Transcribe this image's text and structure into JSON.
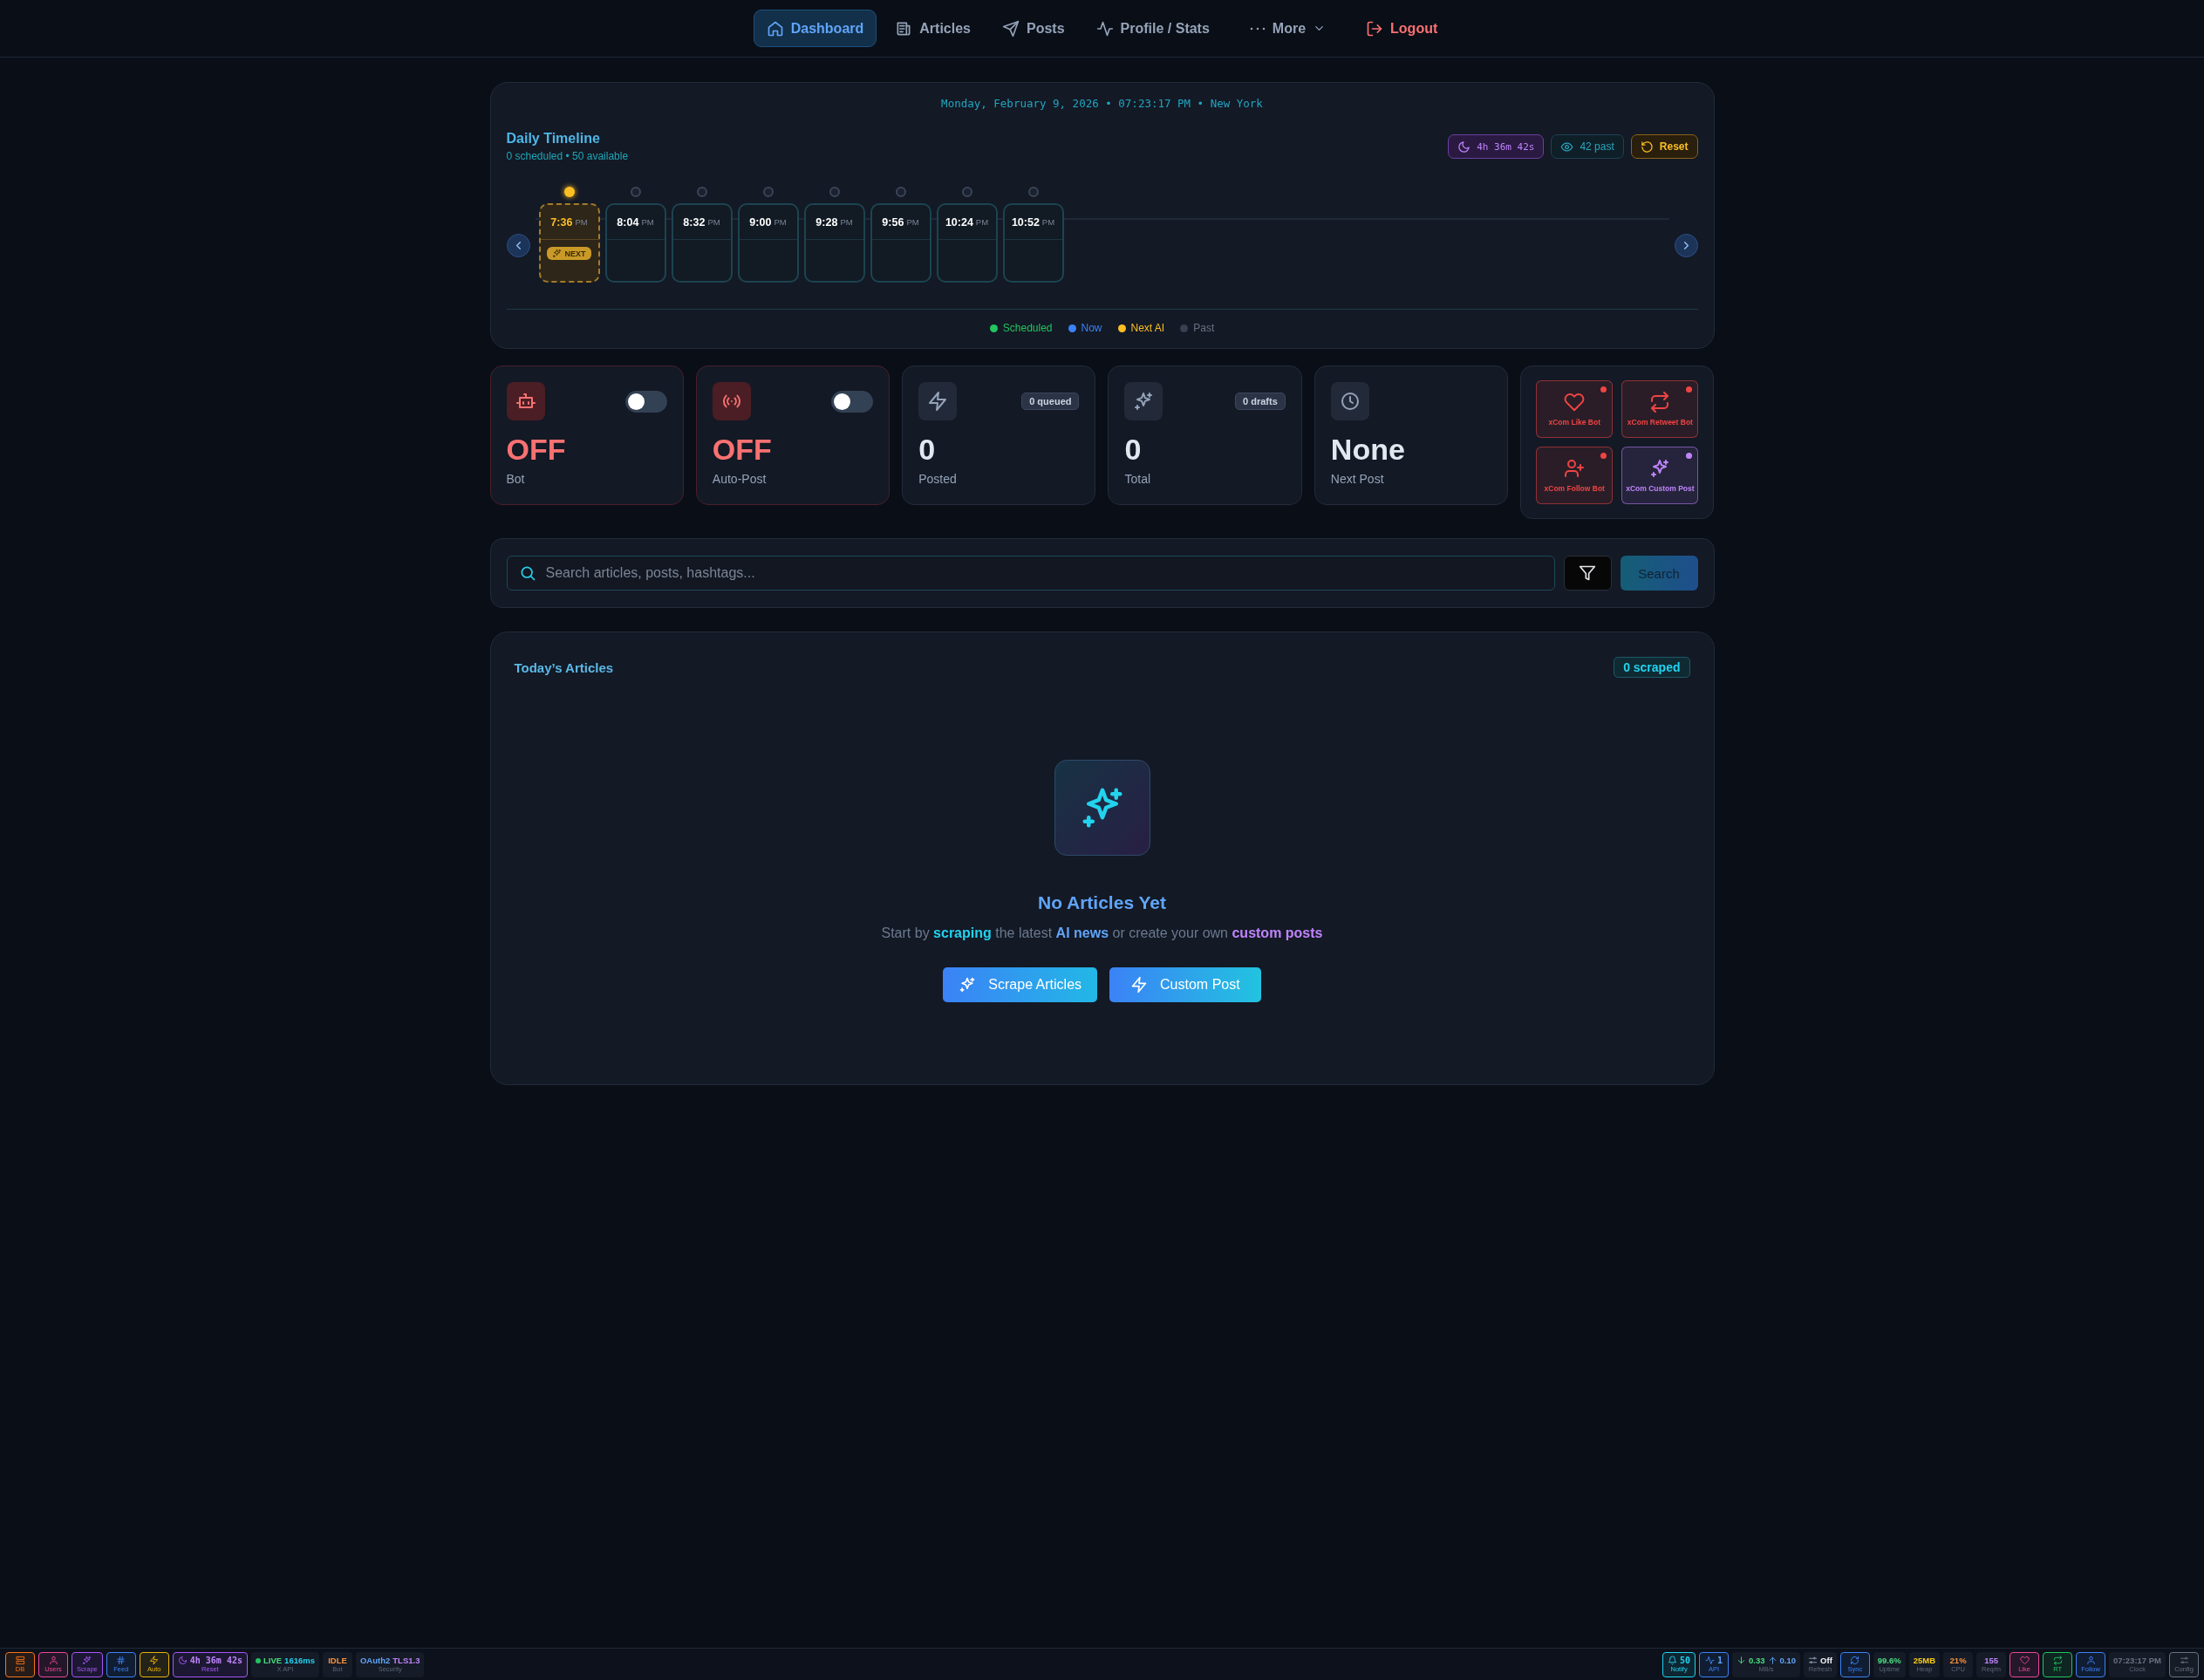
{
  "nav": [
    {
      "label": "Dashboard",
      "kind": "link",
      "selected": true
    },
    {
      "label": "Articles",
      "kind": "link",
      "selected": false
    },
    {
      "label": "Posts",
      "kind": "link",
      "selected": false
    },
    {
      "label": "Profile / Stats",
      "kind": "link",
      "selected": false
    },
    {
      "label": "More",
      "kind": "menu",
      "selected": false
    },
    {
      "label": "Logout",
      "kind": "danger",
      "selected": false
    }
  ],
  "timeline": {
    "datetime": "Monday, February 9, 2026 • 07:23:17 PM • New York",
    "title": "Daily Timeline",
    "subtitle": "0 scheduled • 50 available",
    "badges": [
      {
        "kind": "countdown",
        "text": "4h 36m 42s"
      },
      {
        "kind": "past",
        "text": "42 past"
      },
      {
        "kind": "reset",
        "text": "Reset"
      }
    ],
    "slots": [
      {
        "time": "7:36",
        "period": "PM",
        "next": true,
        "badge": "NEXT"
      },
      {
        "time": "8:04",
        "period": "PM",
        "next": false
      },
      {
        "time": "8:32",
        "period": "PM",
        "next": false
      },
      {
        "time": "9:00",
        "period": "PM",
        "next": false
      },
      {
        "time": "9:28",
        "period": "PM",
        "next": false
      },
      {
        "time": "9:56",
        "period": "PM",
        "next": false
      },
      {
        "time": "10:24",
        "period": "PM",
        "next": false
      },
      {
        "time": "10:52",
        "period": "PM",
        "next": false
      }
    ],
    "legend": [
      {
        "label": "Scheduled",
        "color": "#22c55e"
      },
      {
        "label": "Now",
        "color": "#3b82f6"
      },
      {
        "label": "Next AI",
        "color": "#fbbf24"
      },
      {
        "label": "Past",
        "color": "#374151"
      }
    ]
  },
  "stats": [
    {
      "kind": "toggle",
      "value": "OFF",
      "label": "Bot",
      "on": false
    },
    {
      "kind": "toggle",
      "value": "OFF",
      "label": "Auto-Post",
      "on": false
    },
    {
      "kind": "count",
      "value": "0",
      "label": "Posted",
      "tag": "0 queued"
    },
    {
      "kind": "count",
      "value": "0",
      "label": "Total",
      "tag": "0 drafts"
    },
    {
      "kind": "plain",
      "value": "None",
      "label": "Next Post"
    }
  ],
  "bots": [
    {
      "label": "xCom Like Bot",
      "color": "#ef4444"
    },
    {
      "label": "xCom Retweet Bot",
      "color": "#ef4444"
    },
    {
      "label": "xCom Follow Bot",
      "color": "#ef4444"
    },
    {
      "label": "xCom Custom Post",
      "color": "#c084fc"
    }
  ],
  "search": {
    "placeholder": "Search articles, posts, hashtags...",
    "button": "Search"
  },
  "articles": {
    "title": "Today’s Articles",
    "badge": "0 scraped",
    "empty_title": "No Articles Yet",
    "empty_text": "Start by **scraping** the latest **AI news** or create your own **custom posts**",
    "buttons": [
      "Scrape Articles",
      "Custom Post"
    ]
  },
  "status_bar": {
    "left": [
      {
        "kind": "button",
        "label": "DB",
        "color": "#f97316"
      },
      {
        "kind": "button",
        "label": "Users",
        "color": "#ec4899"
      },
      {
        "kind": "button",
        "label": "Scrape",
        "color": "#a855f7"
      },
      {
        "kind": "button",
        "label": "Feed",
        "color": "#3b82f6"
      },
      {
        "kind": "button",
        "label": "Auto",
        "color": "#eab308"
      },
      {
        "kind": "button",
        "label": "Reset",
        "color": "#a855f7",
        "values": [
          {
            "text": "4h 36m 42s",
            "color": "#c084fc"
          }
        ]
      },
      {
        "kind": "stat",
        "label": "X API",
        "values": [
          {
            "text": "LIVE",
            "color": "#4ade80"
          },
          {
            "text": "1616ms",
            "color": "#22d3ee"
          }
        ]
      },
      {
        "kind": "stat",
        "label": "Bot",
        "values": [
          {
            "text": "IDLE",
            "color": "#fb923c"
          }
        ]
      },
      {
        "kind": "stat",
        "label": "Security",
        "values": [
          {
            "text": "OAuth2",
            "color": "#60a5fa"
          },
          {
            "text": "TLS1.3",
            "color": "#c084fc"
          }
        ]
      }
    ],
    "right": [
      {
        "kind": "button",
        "label": "Notify",
        "color": "#22d3ee",
        "values": [
          {
            "text": "50",
            "color": "#22d3ee"
          }
        ]
      },
      {
        "kind": "button",
        "label": "API",
        "color": "#3b82f6",
        "values": [
          {
            "text": "1",
            "color": "#60a5fa"
          }
        ]
      },
      {
        "kind": "stat",
        "label": "MB/s",
        "values": [
          {
            "text": "0.33",
            "color": "#4ade80"
          },
          {
            "text": "0.10",
            "color": "#60a5fa"
          }
        ]
      },
      {
        "kind": "stat",
        "label": "Refresh",
        "values": [
          {
            "text": "Off",
            "color": "#f8fafc"
          }
        ]
      },
      {
        "kind": "button",
        "label": "Sync",
        "color": "#3b82f6"
      },
      {
        "kind": "stat",
        "label": "Uptime",
        "values": [
          {
            "text": "99.6%",
            "color": "#4ade80"
          }
        ]
      },
      {
        "kind": "stat",
        "label": "Heap",
        "values": [
          {
            "text": "25MB",
            "color": "#facc15"
          }
        ]
      },
      {
        "kind": "stat",
        "label": "CPU",
        "values": [
          {
            "text": "21%",
            "color": "#fb923c"
          }
        ]
      },
      {
        "kind": "stat",
        "label": "Req/m",
        "values": [
          {
            "text": "155",
            "color": "#c084fc"
          }
        ]
      },
      {
        "kind": "button",
        "label": "Like",
        "color": "#ec4899"
      },
      {
        "kind": "button",
        "label": "RT",
        "color": "#22c55e"
      },
      {
        "kind": "button",
        "label": "Follow",
        "color": "#3b82f6"
      },
      {
        "kind": "stat",
        "label": "Clock",
        "values": [
          {
            "text": "07:23:17 PM",
            "color": "#6b7280"
          }
        ]
      },
      {
        "kind": "button",
        "label": "Config",
        "color": "#6b7280"
      }
    ]
  }
}
